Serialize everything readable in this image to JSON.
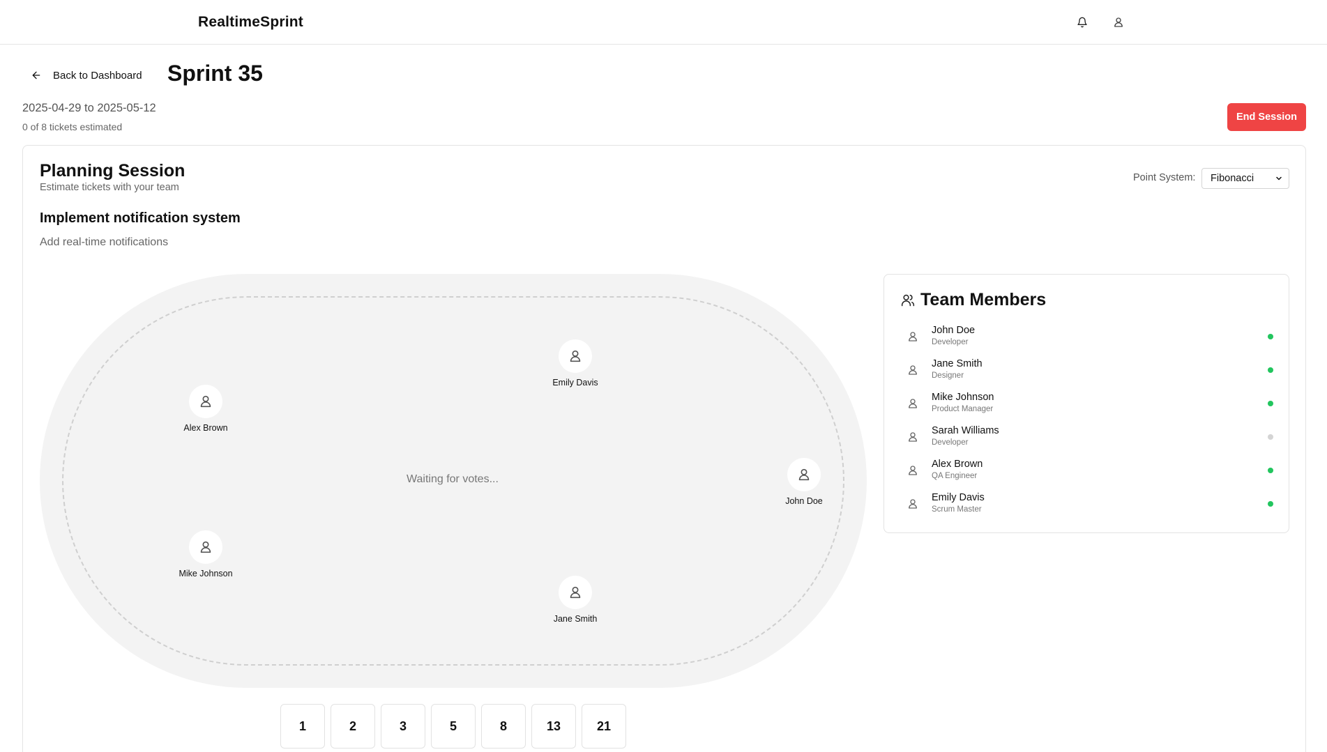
{
  "header": {
    "brand": "RealtimeSprint"
  },
  "nav": {
    "back_label": "Back to Dashboard"
  },
  "sprint": {
    "title": "Sprint 35",
    "dates": "2025-04-29 to 2025-05-12",
    "progress": "0 of 8 tickets estimated",
    "end_label": "End Session"
  },
  "session": {
    "title": "Planning Session",
    "subtitle": "Estimate tickets with your team",
    "point_system_label": "Point System:",
    "point_system_value": "Fibonacci"
  },
  "ticket": {
    "title": "Implement notification system",
    "description": "Add real-time notifications"
  },
  "table": {
    "status": "Waiting for votes...",
    "seats": [
      "Emily Davis",
      "Alex Brown",
      "John Doe",
      "Mike Johnson",
      "Jane Smith"
    ]
  },
  "team": {
    "title": "Team Members",
    "members": [
      {
        "name": "John Doe",
        "role": "Developer",
        "online": true
      },
      {
        "name": "Jane Smith",
        "role": "Designer",
        "online": true
      },
      {
        "name": "Mike Johnson",
        "role": "Product Manager",
        "online": true
      },
      {
        "name": "Sarah Williams",
        "role": "Developer",
        "online": false
      },
      {
        "name": "Alex Brown",
        "role": "QA Engineer",
        "online": true
      },
      {
        "name": "Emily Davis",
        "role": "Scrum Master",
        "online": true
      }
    ]
  },
  "cards": [
    "1",
    "2",
    "3",
    "5",
    "8",
    "13",
    "21"
  ],
  "colors": {
    "accent_red": "#ef4444",
    "online_green": "#22c55e",
    "offline_gray": "#d4d4d4"
  },
  "icons": [
    "bell-icon",
    "user-icon",
    "arrow-left-icon",
    "users-icon",
    "chevron-down-icon"
  ]
}
